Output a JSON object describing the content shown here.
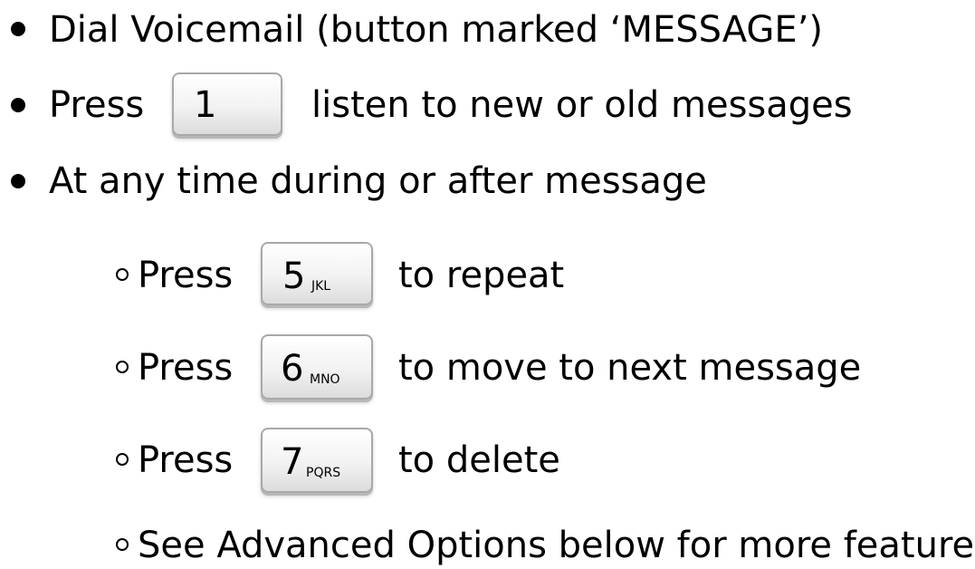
{
  "items": [
    {
      "text": "Dial Voicemail (button marked ‘MESSAGE’)"
    },
    {
      "before": "Press",
      "key": {
        "digit": "1",
        "letters": ""
      },
      "after": "listen to new or old messages"
    },
    {
      "text": "At any time during or after message"
    }
  ],
  "subitems": [
    {
      "before": "Press",
      "key": {
        "digit": "5",
        "letters": "JKL"
      },
      "after": "to repeat"
    },
    {
      "before": "Press",
      "key": {
        "digit": "6",
        "letters": "MNO"
      },
      "after": "to move to next message"
    },
    {
      "before": "Press",
      "key": {
        "digit": "7",
        "letters": "PQRS"
      },
      "after": "to delete"
    },
    {
      "text": "See Advanced Options below for more features"
    }
  ]
}
